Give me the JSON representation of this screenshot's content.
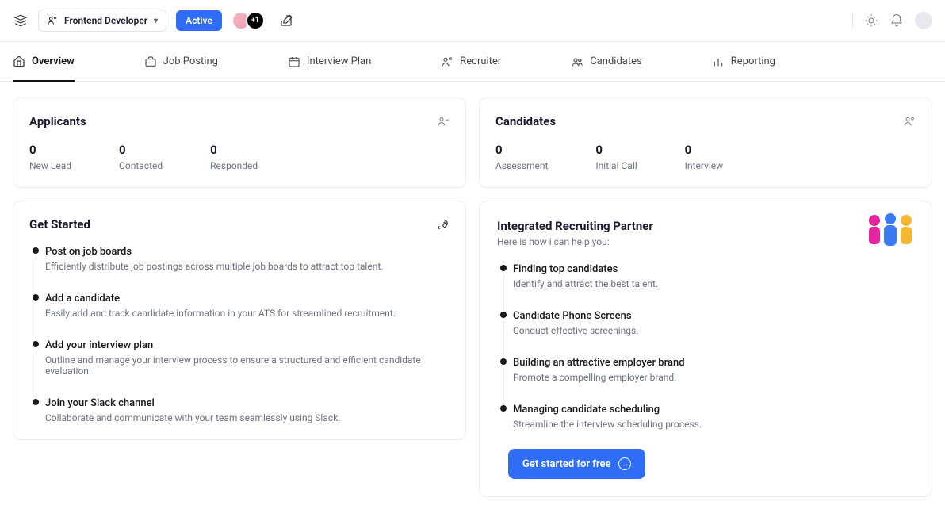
{
  "header": {
    "job_title": "Frontend Developer",
    "status": "Active",
    "avatar_overflow": "+1"
  },
  "tabs": [
    {
      "label": "Overview"
    },
    {
      "label": "Job Posting"
    },
    {
      "label": "Interview Plan"
    },
    {
      "label": "Recruiter"
    },
    {
      "label": "Candidates"
    },
    {
      "label": "Reporting"
    }
  ],
  "applicants": {
    "title": "Applicants",
    "stats": [
      {
        "num": "0",
        "label": "New Lead"
      },
      {
        "num": "0",
        "label": "Contacted"
      },
      {
        "num": "0",
        "label": "Responded"
      }
    ]
  },
  "candidates": {
    "title": "Candidates",
    "stats": [
      {
        "num": "0",
        "label": "Assessment"
      },
      {
        "num": "0",
        "label": "Initial Call"
      },
      {
        "num": "0",
        "label": "Interview"
      }
    ]
  },
  "get_started": {
    "title": "Get Started",
    "items": [
      {
        "title": "Post on job boards",
        "sub": "Efficiently distribute job postings across multiple job boards to attract top talent."
      },
      {
        "title": "Add a candidate",
        "sub": "Easily add and track candidate information in your ATS for streamlined recruitment."
      },
      {
        "title": "Add your interview plan",
        "sub": "Outline and manage your interview process to ensure a structured and efficient candidate evaluation."
      },
      {
        "title": "Join your Slack channel",
        "sub": "Collaborate and communicate with your team seamlessly using Slack."
      }
    ]
  },
  "partner": {
    "title": "Integrated Recruiting Partner",
    "sub": "Here is how i can help you:",
    "items": [
      {
        "title": "Finding top candidates",
        "sub": "Identify and attract the best talent."
      },
      {
        "title": "Candidate Phone Screens",
        "sub": "Conduct effective screenings."
      },
      {
        "title": "Building an attractive employer brand",
        "sub": "Promote a compelling employer brand."
      },
      {
        "title": "Managing candidate scheduling",
        "sub": "Streamline the interview scheduling process."
      }
    ],
    "cta": "Get started for free"
  }
}
